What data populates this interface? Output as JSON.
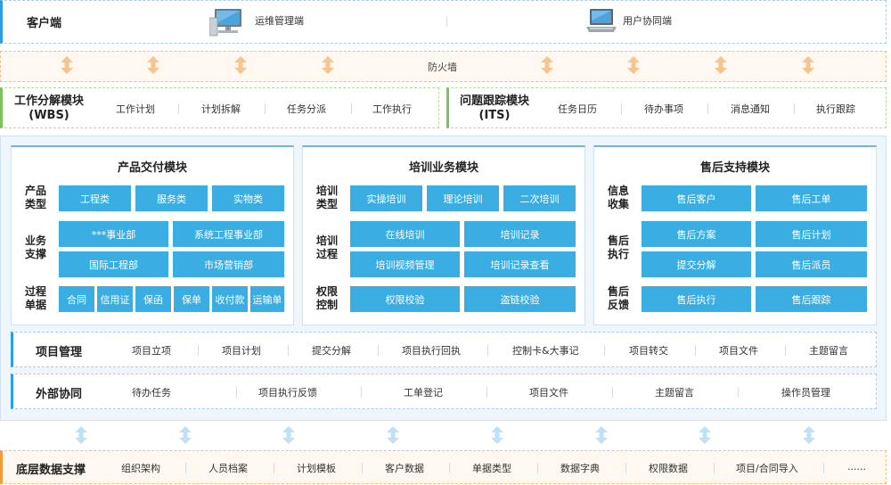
{
  "client": {
    "title": "客户端",
    "items": [
      "运维管理端",
      "用户协同端"
    ],
    "icons": [
      "desktop-computer-icon",
      "laptop-icon"
    ]
  },
  "firewall": {
    "label": "防火墙"
  },
  "wbs": {
    "title_line1": "工作分解模块",
    "title_line2": "(WBS)",
    "items": [
      "工作计划",
      "计划拆解",
      "任务分派",
      "工作执行"
    ]
  },
  "its": {
    "title_line1": "问题跟踪模块",
    "title_line2": "(ITS)",
    "items": [
      "任务日历",
      "待办事项",
      "消息通知",
      "执行跟踪"
    ]
  },
  "panels": {
    "product": {
      "title": "产品交付模块",
      "rows": [
        {
          "label": [
            "产品",
            "类型"
          ]
        },
        {
          "label": [
            "业务",
            "支撑"
          ]
        },
        {
          "label": [
            "过程",
            "单据"
          ]
        }
      ],
      "cells": {
        "type": [
          "工程类",
          "服务类",
          "实物类"
        ],
        "support": [
          "***事业部",
          "系统工程事业部",
          "国际工程部",
          "市场营销部"
        ],
        "docs": [
          "合同",
          "信用证",
          "保函",
          "保单",
          "收付款",
          "运输单"
        ]
      }
    },
    "training": {
      "title": "培训业务模块",
      "rows": [
        {
          "label": [
            "培训",
            "类型"
          ]
        },
        {
          "label": [
            "培训",
            "过程"
          ]
        },
        {
          "label": [
            "权限",
            "控制"
          ]
        }
      ],
      "cells": {
        "type": [
          "实操培训",
          "理论培训",
          "二次培训"
        ],
        "process": [
          "在线培训",
          "培训记录",
          "培训视频管理",
          "培训记录查看"
        ],
        "auth": [
          "权限校验",
          "盗链校验"
        ]
      }
    },
    "aftersales": {
      "title": "售后支持模块",
      "rows": [
        {
          "label": [
            "信息",
            "收集"
          ]
        },
        {
          "label": [
            "售后",
            "执行"
          ]
        },
        {
          "label": [
            "售后",
            "反馈"
          ]
        }
      ],
      "cells": {
        "info": [
          "售后客户",
          "售后工单"
        ],
        "exec": [
          "售后方案",
          "售后计划",
          "提交分解",
          "售后派员"
        ],
        "feedback": [
          "售后执行",
          "售后跟踪"
        ]
      }
    }
  },
  "project": {
    "title": "项目管理",
    "items": [
      "项目立项",
      "项目计划",
      "提交分解",
      "项目执行回执",
      "控制卡&大事记",
      "项目转交",
      "项目文件",
      "主题留言"
    ]
  },
  "external": {
    "title": "外部协同",
    "items": [
      "待办任务",
      "项目执行反馈",
      "工单登记",
      "项目文件",
      "主题留言",
      "操作员管理"
    ]
  },
  "bottom": {
    "title": "底层数据支撑",
    "items": [
      "组织架构",
      "人员档案",
      "计划模板",
      "客户数据",
      "单据类型",
      "数据字典",
      "权限数据",
      "项目/合同导入",
      "......"
    ]
  },
  "colors": {
    "accent_blue": "#2d9fe0",
    "cell_blue": "#3aaee2",
    "accent_green": "#7cc15c",
    "accent_orange": "#f29b3c",
    "arrow_orange": "#f7c48d",
    "arrow_blue": "#bfe0f5"
  }
}
